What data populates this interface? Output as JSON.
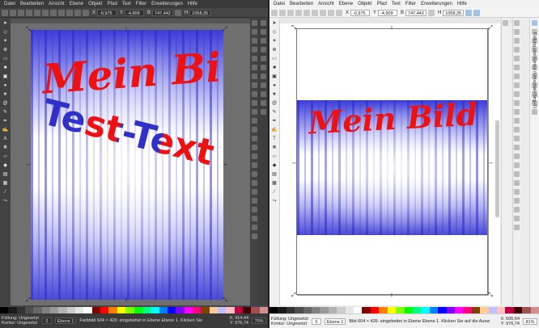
{
  "menu": [
    "Datei",
    "Bearbeiten",
    "Ansicht",
    "Ebene",
    "Objekt",
    "Pfad",
    "Text",
    "Filter",
    "Erweiterungen",
    "Hilfe"
  ],
  "controls": {
    "x_label": "X",
    "x_value": "-0,975",
    "y_label": "Y",
    "y_value": "-4,909",
    "w_label": "B",
    "w_value": "747,442",
    "h_label": "H",
    "h_value": "1058,35"
  },
  "left_canvas": {
    "title": "Mein Bild",
    "subtitle": "Test-Text"
  },
  "right_canvas": {
    "title": "Mein Bild"
  },
  "right_panel_label": "Füllung und Kontur (Umschalt+Strg+F)",
  "status": {
    "fill_label": "Füllung:",
    "fill_value": "Ungesetzt",
    "stroke_label": "Kontur:",
    "stroke_value": "Ungesetzt",
    "opacity": "0",
    "layer": "Ebene 1",
    "left_message": "Farbbild 604 × 426: eingebettet in Ebene Ebene 1. Klicken Sie",
    "right_message": "Bild 604 × 426: eingebettet in Ebene Ebene 1. Klicken Sie auf die Ausw",
    "left_x": "X: 414,44",
    "left_y": "Y: 976,74",
    "left_zoom": "70%",
    "right_x": "X: 505,64",
    "right_y": "Y: 976,74",
    "right_zoom": "81%"
  },
  "palette": [
    "#000000",
    "#1a1a1a",
    "#333333",
    "#4d4d4d",
    "#666666",
    "#808080",
    "#999999",
    "#b3b3b3",
    "#cccccc",
    "#e6e6e6",
    "#ffffff",
    "#800000",
    "#ff0000",
    "#ff8000",
    "#ffff00",
    "#80ff00",
    "#00ff00",
    "#00ff80",
    "#00ffff",
    "#0080ff",
    "#0000ff",
    "#8000ff",
    "#ff00ff",
    "#ff0080",
    "#804000",
    "#ffcc99",
    "#c0c0ff",
    "#ffc0c0",
    "#c00040",
    "#400000",
    "#a05050",
    "#d09090"
  ],
  "colors": {
    "accent_red": "#ee1111",
    "accent_blue": "#3030c8"
  }
}
